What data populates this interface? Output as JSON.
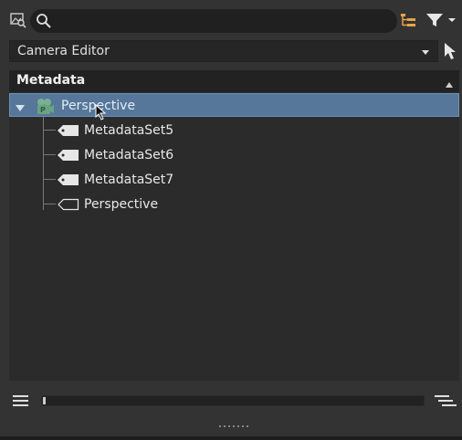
{
  "toolbar": {
    "search": {
      "value": "",
      "placeholder": ""
    },
    "icons": [
      "image-search-icon",
      "search-icon",
      "hierarchy-icon",
      "filter-icon"
    ]
  },
  "editor_select": {
    "selected": "Camera Editor"
  },
  "panel": {
    "title": "Metadata",
    "tree": {
      "root": {
        "label": "Perspective",
        "icon": "camera-object-icon",
        "expanded": true,
        "selected": true
      },
      "children": [
        {
          "label": "MetadataSet5",
          "icon": "tag-filled-icon"
        },
        {
          "label": "MetadataSet6",
          "icon": "tag-filled-icon"
        },
        {
          "label": "MetadataSet7",
          "icon": "tag-filled-icon"
        },
        {
          "label": "Perspective",
          "icon": "tag-outline-icon"
        }
      ]
    }
  },
  "bottom": {
    "scroll_position": 0.0
  },
  "colors": {
    "accent_orange": "#e6a44a",
    "selection": "#56779a",
    "background": "#333333"
  }
}
